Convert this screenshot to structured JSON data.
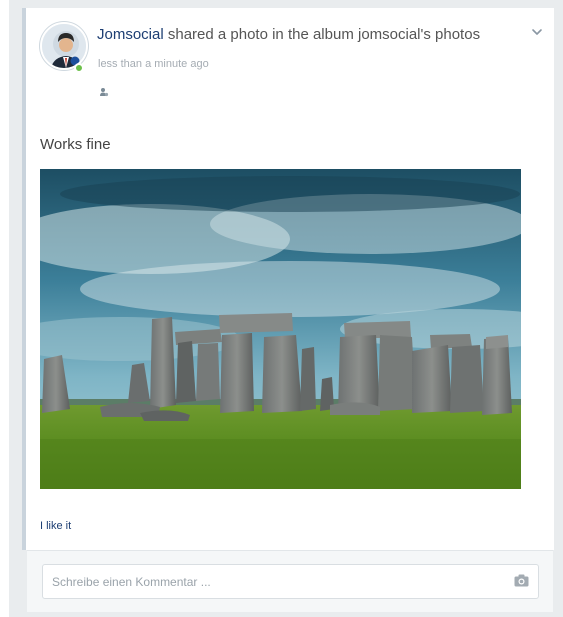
{
  "post": {
    "actor": "Jomsocial",
    "action_text": " shared a photo in the album jomsocial's photos",
    "timestamp": "less than a minute ago",
    "privacy_icon": "public-user-icon",
    "options_icon": "chevron-down-icon",
    "message": "Works fine",
    "photo_alt": "Stonehenge",
    "like_label": "I like it"
  },
  "comment": {
    "placeholder": "Schreibe einen Kommentar ...",
    "attach_icon": "camera-icon"
  },
  "colors": {
    "link": "#1d3e73",
    "online": "#6cc04a",
    "card_border": "#c9d3dc",
    "frame": "#e9ecee"
  }
}
